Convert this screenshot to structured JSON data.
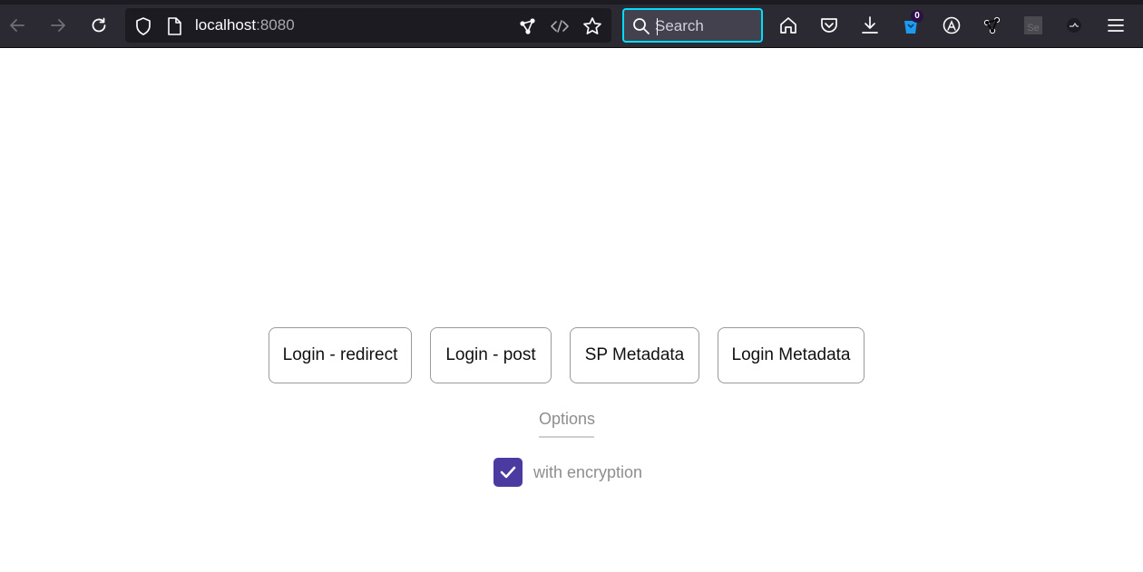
{
  "browser": {
    "url": {
      "host": "localhost",
      "port": ":8080"
    },
    "search": {
      "placeholder": "Search",
      "value": ""
    },
    "notification_badge": "0",
    "icons": {
      "back": "arrow-left-icon",
      "forward": "arrow-right-icon",
      "reload": "reload-icon",
      "shield": "tracking-protection-shield-icon",
      "page": "page-info-icon",
      "extension_url": "graph-extension-icon",
      "code": "code-icon",
      "bookmark": "star-icon",
      "home": "home-icon",
      "pocket": "pocket-icon",
      "downloads": "download-icon",
      "extension_blue": "blue-extension-icon",
      "translate": "translate-icon",
      "extension_graph": "graph-extension-icon",
      "selenium": "selenium-icon",
      "extension_dark": "dark-extension-icon",
      "menu": "hamburger-menu-icon"
    },
    "colors": {
      "toolbar": "#2b2a33",
      "search_focus": "#00ddff"
    }
  },
  "page": {
    "buttons": [
      {
        "label": "Login - redirect"
      },
      {
        "label": "Login - post"
      },
      {
        "label": "SP Metadata"
      },
      {
        "label": "Login Metadata"
      }
    ],
    "options_tab": "Options",
    "encryption_checkbox": {
      "label": "with encryption",
      "checked": true
    },
    "colors": {
      "checkbox": "#4b3aa0"
    }
  }
}
